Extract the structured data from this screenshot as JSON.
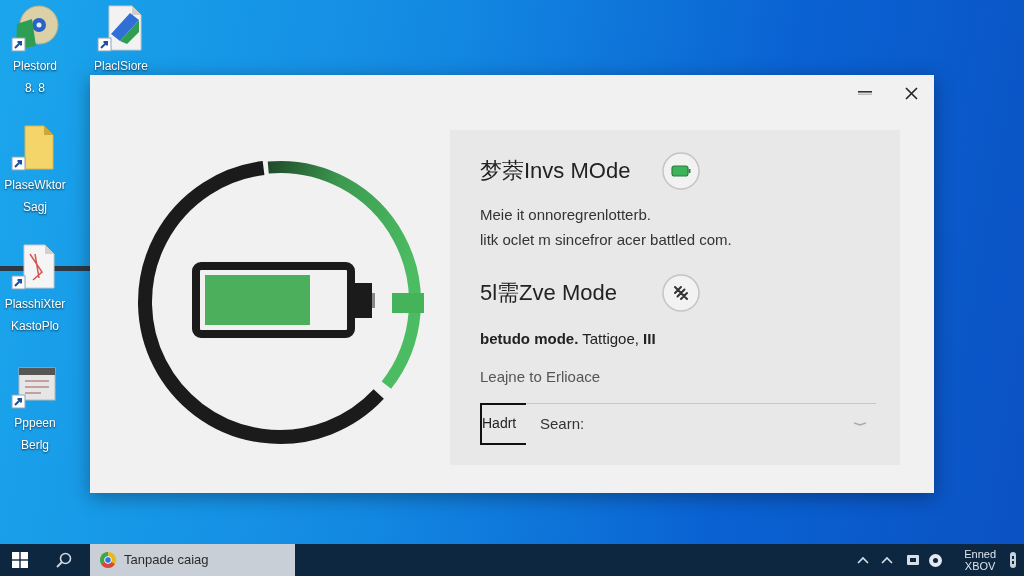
{
  "desktop": {
    "columns": [
      [
        {
          "kind": "disc",
          "lines": [
            "Plestord",
            "8. 8"
          ]
        },
        {
          "kind": "folder",
          "lines": [
            "PlaseWktor",
            "Sagj"
          ]
        },
        {
          "kind": "pdf",
          "lines": [
            "PlasshiXter",
            "KastoPlo"
          ]
        },
        {
          "kind": "calendar",
          "lines": [
            "Pppeen",
            "Berlg"
          ]
        }
      ],
      [
        {
          "kind": "document",
          "lines": [
            "PlaclSiore"
          ]
        }
      ]
    ]
  },
  "modes": [
    {
      "kind": "battery",
      "title": "梦萘Invs MOde",
      "description": [
        "Meie it onnoregrenlotterb.",
        "litk oclet m sincefror acer battled com."
      ]
    },
    {
      "kind": "slashed",
      "title": "5l需Zve Mode",
      "description": [
        "**betudo mode.** Tattigoe, **III**"
      ]
    }
  ],
  "hint": "Leajne to Erlioace",
  "dropdown": {
    "label": "Hadrt",
    "value": "Searn:"
  },
  "taskbar": {
    "apps": [
      {
        "label": "Tanpade caiag",
        "selected": true
      }
    ],
    "clock": [
      "Enned",
      "XBOV"
    ]
  }
}
